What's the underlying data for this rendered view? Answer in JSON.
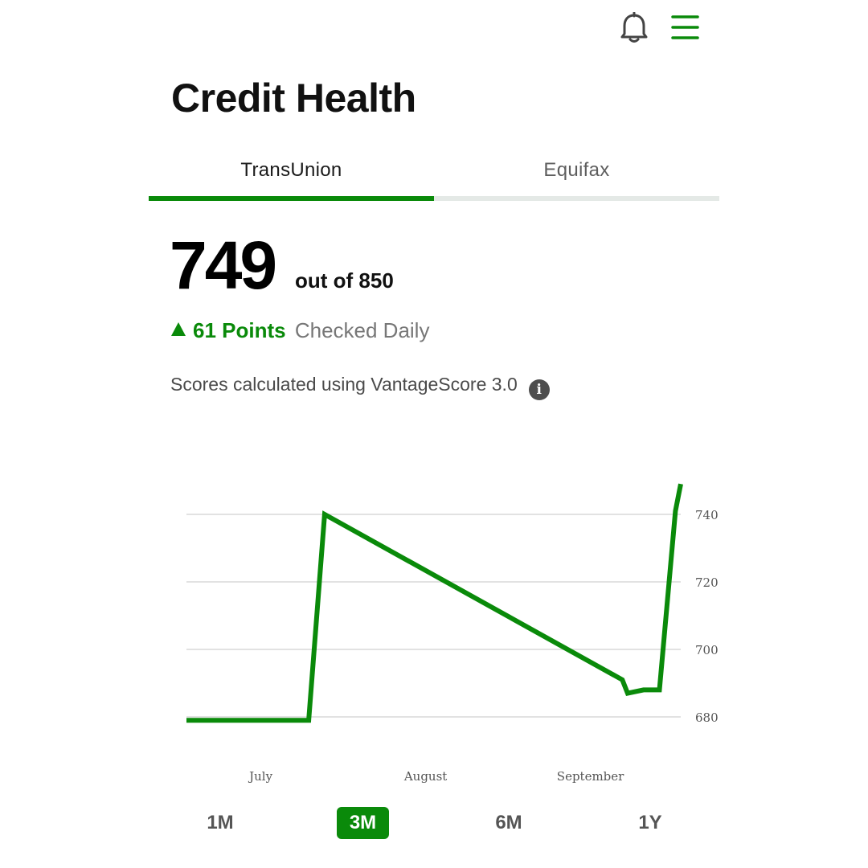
{
  "header": {
    "bell_icon": "bell-icon",
    "menu_icon": "hamburger-menu-icon"
  },
  "page": {
    "title": "Credit Health"
  },
  "tabs": [
    {
      "label": "TransUnion",
      "active": true
    },
    {
      "label": "Equifax",
      "active": false
    }
  ],
  "score": {
    "value": "749",
    "max_text": "out of 850",
    "change_points": "61 Points",
    "change_frequency": "Checked Daily",
    "trend_icon": "up-arrow-icon",
    "model_note": "Scores calculated using VantageScore 3.0",
    "info_icon": "info-icon"
  },
  "chart_data": {
    "type": "line",
    "title": "",
    "xlabel": "",
    "ylabel": "",
    "x_tick_labels": [
      "July",
      "August",
      "September"
    ],
    "y_ticks": [
      680,
      700,
      720,
      740
    ],
    "ylim": [
      672,
      750
    ],
    "grid": true,
    "y_axis_side": "right",
    "series": [
      {
        "color": "#0a8a0a",
        "points": [
          {
            "x": "2020-06-17",
            "y": 679
          },
          {
            "x": "2020-07-10",
            "y": 679
          },
          {
            "x": "2020-07-13",
            "y": 740
          },
          {
            "x": "2020-09-07",
            "y": 691
          },
          {
            "x": "2020-09-08",
            "y": 687
          },
          {
            "x": "2020-09-11",
            "y": 688
          },
          {
            "x": "2020-09-14",
            "y": 688
          },
          {
            "x": "2020-09-17",
            "y": 741
          },
          {
            "x": "2020-09-18",
            "y": 749
          }
        ]
      }
    ],
    "x_tick_dates": [
      "2020-07-01",
      "2020-08-01",
      "2020-09-01"
    ]
  },
  "ranges": [
    {
      "label": "1M",
      "active": false
    },
    {
      "label": "3M",
      "active": true
    },
    {
      "label": "6M",
      "active": false
    },
    {
      "label": "1Y",
      "active": false
    }
  ],
  "colors": {
    "accent": "#0a8a0a",
    "gridline": "#d8d8d8",
    "tab_track": "#e4e9e6"
  }
}
